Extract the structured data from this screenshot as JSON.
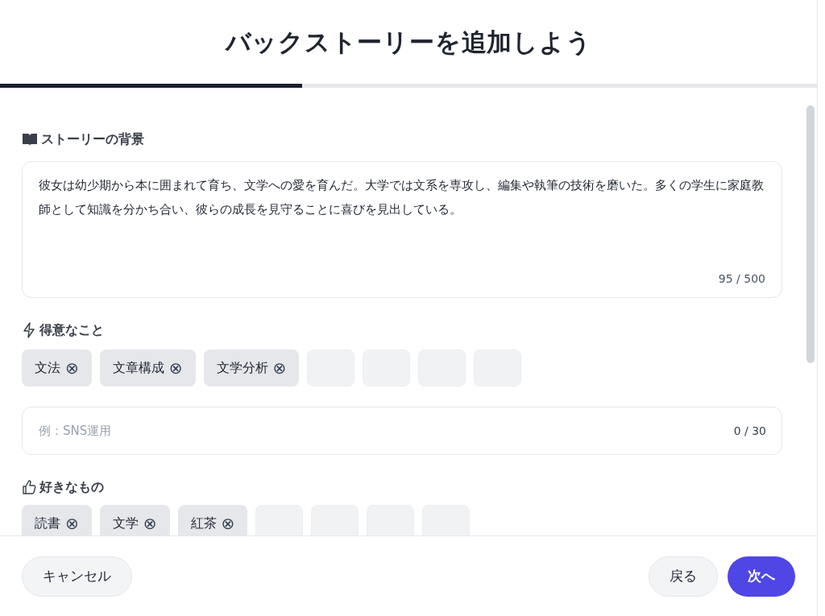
{
  "title": "バックストーリーを追加しよう",
  "progress": {
    "level": 0.37
  },
  "background": {
    "label": "ストーリーの背景",
    "value": "彼女は幼少期から本に囲まれて育ち、文学への愛を育んだ。大学では文系を専攻し、編集や執筆の技術を磨いた。多くの学生に家庭教師として知識を分かち合い、彼らの成長を見守ることに喜びを見出している。",
    "counter": "95 / 500"
  },
  "strengths": {
    "label": "得意なこと",
    "tags": [
      {
        "kind": "tag",
        "text": "文法",
        "remove": "⊗"
      },
      {
        "kind": "tag",
        "text": "文章構成",
        "remove": "⊗"
      },
      {
        "kind": "tag",
        "text": "文学分析",
        "remove": "⊗"
      },
      {
        "kind": "slot"
      },
      {
        "kind": "slot"
      },
      {
        "kind": "slot"
      },
      {
        "kind": "slot"
      }
    ],
    "input": {
      "placeholder": "例：SNS運用",
      "counter": "0 / 30"
    }
  },
  "likes": {
    "label": "好きなもの",
    "tags": [
      {
        "kind": "tag",
        "text": "読書",
        "remove": "⊗"
      },
      {
        "kind": "tag",
        "text": "文学",
        "remove": "⊗"
      },
      {
        "kind": "tag",
        "text": "紅茶",
        "remove": "⊗"
      },
      {
        "kind": "slot"
      },
      {
        "kind": "slot"
      },
      {
        "kind": "slot"
      },
      {
        "kind": "slot"
      }
    ]
  },
  "buttons": {
    "cancel": "キャンセル",
    "back": "戻る",
    "next": "次へ"
  }
}
